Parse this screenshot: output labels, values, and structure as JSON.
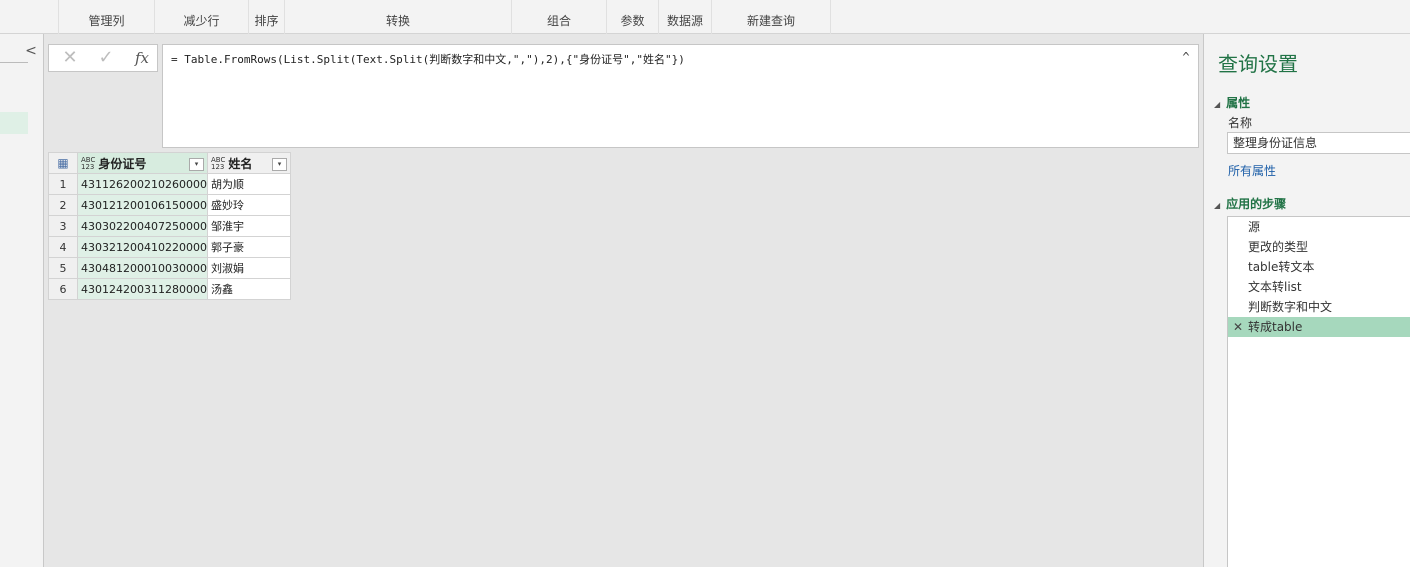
{
  "ribbon": {
    "groups": [
      "管理列",
      "减少行",
      "排序",
      "转换",
      "组合",
      "参数",
      "数据源",
      "新建查询"
    ]
  },
  "left_pane": {
    "collapse_glyph": "<"
  },
  "formula_bar": {
    "cancel_glyph": "✕",
    "confirm_glyph": "✓",
    "fx_label": "fx",
    "formula": "= Table.FromRows(List.Split(Text.Split(判断数字和中文,\",\"),2),{\"身份证号\",\"姓名\"})",
    "expand_glyph": "^"
  },
  "grid": {
    "table_icon": "▦",
    "type_icon_top": "ABC",
    "type_icon_bottom": "123",
    "columns": [
      "身份证号",
      "姓名"
    ],
    "filter_glyph": "▾",
    "rows": [
      {
        "n": "1",
        "id": "431126200210260000",
        "name": "胡为顺"
      },
      {
        "n": "2",
        "id": "430121200106150000",
        "name": "盛妙玲"
      },
      {
        "n": "3",
        "id": "430302200407250000",
        "name": "邹淮宇"
      },
      {
        "n": "4",
        "id": "430321200410220000",
        "name": "郭子豪"
      },
      {
        "n": "5",
        "id": "430481200010030000",
        "name": "刘淑娟"
      },
      {
        "n": "6",
        "id": "430124200311280000",
        "name": "汤鑫"
      }
    ]
  },
  "query_settings": {
    "title": "查询设置",
    "properties_header": "属性",
    "name_label": "名称",
    "name_value": "整理身份证信息",
    "all_properties_link": "所有属性",
    "steps_header": "应用的步骤",
    "delete_glyph": "✕",
    "steps": [
      "源",
      "更改的类型",
      "table转文本",
      "文本转list",
      "判断数字和中文",
      "转成table"
    ],
    "active_step": "转成table"
  },
  "colors": {
    "accent": "#217346",
    "selected_step": "#a6d8bd",
    "selected_column": "#dff0e6"
  }
}
